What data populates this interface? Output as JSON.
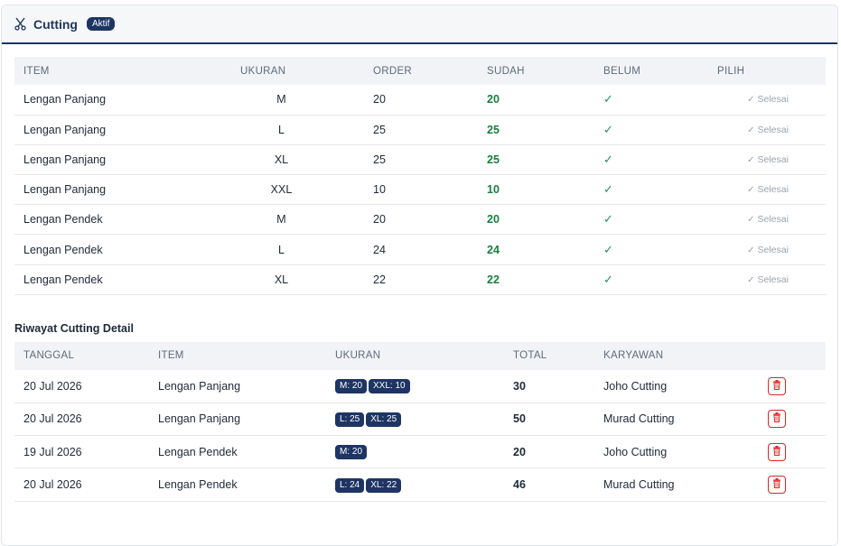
{
  "header": {
    "title": "Cutting",
    "badge": "Aktif"
  },
  "table1": {
    "columns": [
      "ITEM",
      "UKURAN",
      "ORDER",
      "SUDAH",
      "BELUM",
      "PILIH"
    ],
    "rows": [
      {
        "item": "Lengan Panjang",
        "ukuran": "M",
        "order": "20",
        "sudah": "20",
        "belum": "✓",
        "pilih": "Selesai"
      },
      {
        "item": "Lengan Panjang",
        "ukuran": "L",
        "order": "25",
        "sudah": "25",
        "belum": "✓",
        "pilih": "Selesai"
      },
      {
        "item": "Lengan Panjang",
        "ukuran": "XL",
        "order": "25",
        "sudah": "25",
        "belum": "✓",
        "pilih": "Selesai"
      },
      {
        "item": "Lengan Panjang",
        "ukuran": "XXL",
        "order": "10",
        "sudah": "10",
        "belum": "✓",
        "pilih": "Selesai"
      },
      {
        "item": "Lengan Pendek",
        "ukuran": "M",
        "order": "20",
        "sudah": "20",
        "belum": "✓",
        "pilih": "Selesai"
      },
      {
        "item": "Lengan Pendek",
        "ukuran": "L",
        "order": "24",
        "sudah": "24",
        "belum": "✓",
        "pilih": "Selesai"
      },
      {
        "item": "Lengan Pendek",
        "ukuran": "XL",
        "order": "22",
        "sudah": "22",
        "belum": "✓",
        "pilih": "Selesai"
      }
    ]
  },
  "riwayat": {
    "title": "Riwayat Cutting Detail",
    "columns": [
      "TANGGAL",
      "ITEM",
      "UKURAN",
      "TOTAL",
      "KARYAWAN",
      ""
    ],
    "rows": [
      {
        "tanggal": "20 Jul 2026",
        "item": "Lengan Panjang",
        "ukuran": [
          "M: 20",
          "XXL: 10"
        ],
        "total": "30",
        "karyawan": "Joho Cutting"
      },
      {
        "tanggal": "20 Jul 2026",
        "item": "Lengan Panjang",
        "ukuran": [
          "L: 25",
          "XL: 25"
        ],
        "total": "50",
        "karyawan": "Murad Cutting"
      },
      {
        "tanggal": "19 Jul 2026",
        "item": "Lengan Pendek",
        "ukuran": [
          "M: 20"
        ],
        "total": "20",
        "karyawan": "Joho Cutting"
      },
      {
        "tanggal": "20 Jul 2026",
        "item": "Lengan Pendek",
        "ukuran": [
          "L: 24",
          "XL: 22"
        ],
        "total": "46",
        "karyawan": "Murad Cutting"
      }
    ]
  },
  "icons": {
    "header": "scissors-icon",
    "delete": "trash-icon",
    "done": "check-icon"
  },
  "colors": {
    "primary": "#1e3563",
    "success": "#17803d",
    "danger": "#dc2626"
  }
}
